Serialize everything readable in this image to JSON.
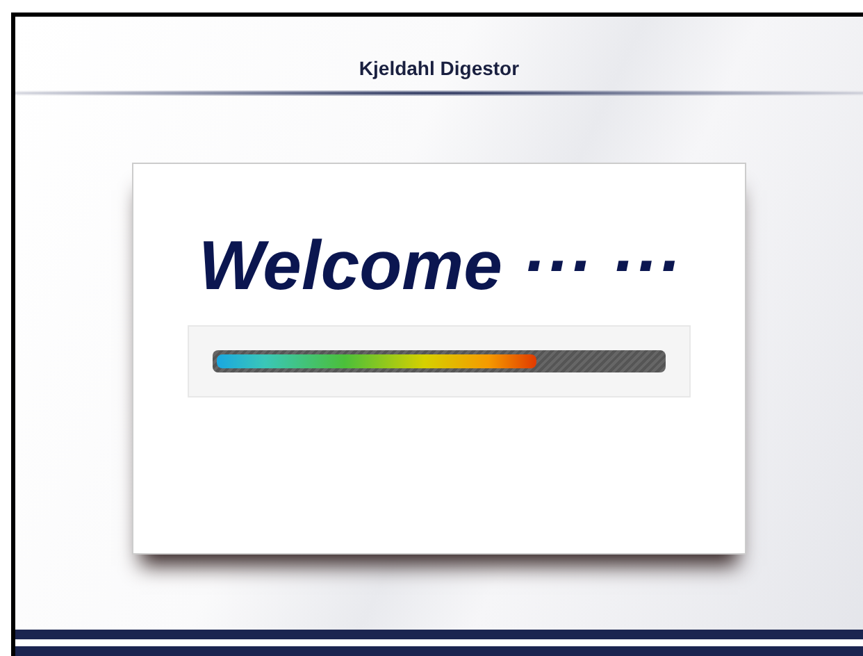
{
  "header": {
    "title": "Kjeldahl Digestor"
  },
  "splash": {
    "greeting": "Welcome ··· ···",
    "progress": {
      "level": 0.72
    }
  }
}
